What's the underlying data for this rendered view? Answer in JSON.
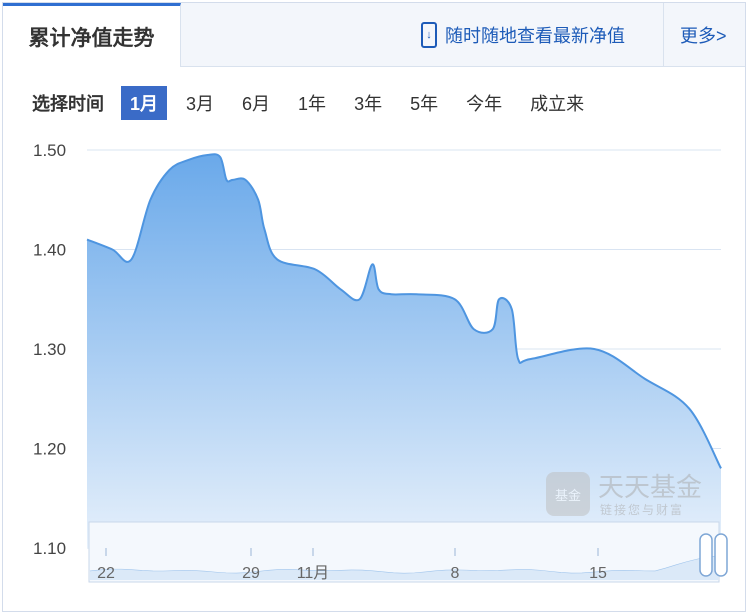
{
  "header": {
    "active_tab": "累计净值走势",
    "promo_text": "随时随地查看最新净值",
    "more_label": "更多>"
  },
  "range": {
    "label": "选择时间",
    "options": [
      "1月",
      "3月",
      "6月",
      "1年",
      "3年",
      "5年",
      "今年",
      "成立来"
    ],
    "selected": "1月"
  },
  "watermark": {
    "name": "天天基金",
    "slogan": "链接您与财富",
    "badge": "基金"
  },
  "colors": {
    "accent": "#3a6bc7",
    "area_top": "#6aa9ea",
    "area_bottom": "#e6f0fb",
    "line": "#4e95e0"
  },
  "chart_data": {
    "type": "area",
    "title": "累计净值走势",
    "ylim": [
      1.1,
      1.5
    ],
    "y_ticks": [
      "1.50",
      "1.40",
      "1.30",
      "1.20",
      "1.10"
    ],
    "x": [
      0,
      0.04,
      0.07,
      0.1,
      0.13,
      0.16,
      0.19,
      0.21,
      0.22,
      0.23,
      0.25,
      0.27,
      0.28,
      0.3,
      0.36,
      0.4,
      0.43,
      0.45,
      0.46,
      0.48,
      0.52,
      0.58,
      0.61,
      0.64,
      0.65,
      0.67,
      0.68,
      0.7,
      0.8,
      0.88,
      0.95,
      1.0
    ],
    "values": [
      1.41,
      1.4,
      1.39,
      1.45,
      1.48,
      1.49,
      1.495,
      1.493,
      1.47,
      1.47,
      1.47,
      1.45,
      1.42,
      1.39,
      1.38,
      1.36,
      1.35,
      1.385,
      1.36,
      1.355,
      1.355,
      1.35,
      1.32,
      1.32,
      1.35,
      1.34,
      1.29,
      1.29,
      1.3,
      1.27,
      1.24,
      1.18
    ],
    "navigator": {
      "x_ticks": [
        "22",
        "29",
        "11月",
        "8",
        "15"
      ]
    }
  }
}
